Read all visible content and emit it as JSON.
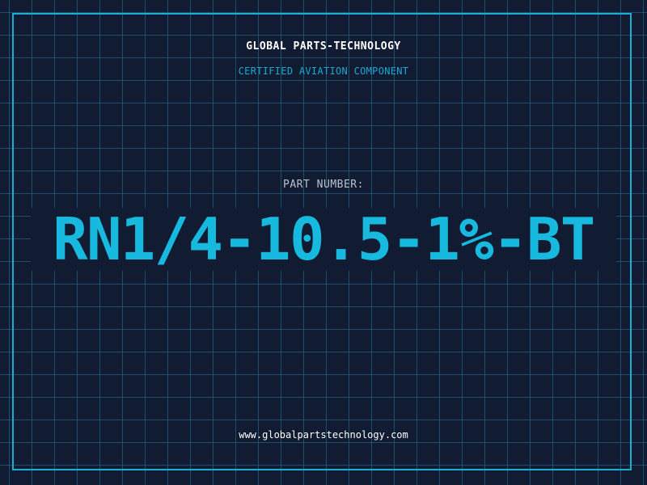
{
  "header": {
    "company_name": "GLOBAL PARTS-TECHNOLOGY",
    "tagline": "CERTIFIED AVIATION COMPONENT"
  },
  "part": {
    "label": "PART NUMBER:",
    "number": "RN1/4-10.5-1%-BT"
  },
  "footer": {
    "website": "www.globalpartstechnology.com"
  },
  "colors": {
    "background": "#111c33",
    "accent": "#17b9de",
    "grid": "#287896",
    "text_light": "#ffffff",
    "text_muted": "#b9c2cf"
  }
}
